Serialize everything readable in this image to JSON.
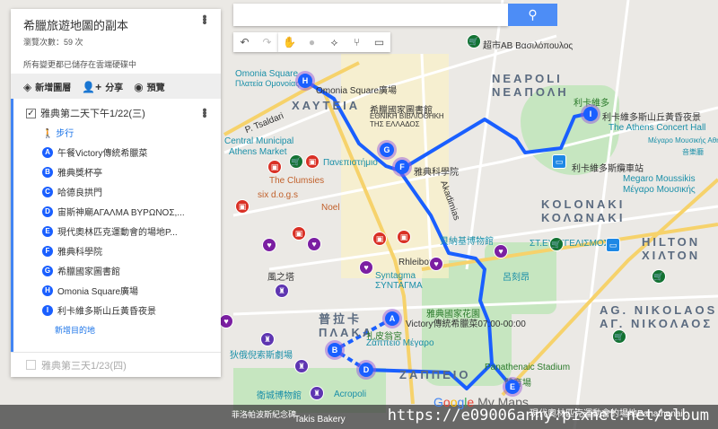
{
  "panel": {
    "title": "希臘旅遊地圖的副本",
    "views": "瀏覽次數：59 次",
    "saved": "所有變更都已儲存在雲端硬碟中",
    "tools": {
      "add_layer": "新增圖層",
      "share": "分享",
      "preview": "預覽"
    },
    "layer1": {
      "title": "雅典第二天下午1/22(三)",
      "mode": "步行",
      "add_dest": "新增目的地",
      "stops": [
        {
          "letter": "A",
          "name": "午餐Victory傳統希臘菜"
        },
        {
          "letter": "B",
          "name": "雅典獎杯亭"
        },
        {
          "letter": "C",
          "name": "哈德良拱門"
        },
        {
          "letter": "D",
          "name": "宙斯神廟ΑΓΑΛΜΑ ΒΥΡΩΝΟΣ,..."
        },
        {
          "letter": "E",
          "name": "現代奧林匹克運動會的場地P..."
        },
        {
          "letter": "F",
          "name": "雅典科學院"
        },
        {
          "letter": "G",
          "name": "希臘國家圖書館"
        },
        {
          "letter": "H",
          "name": "Omonia Square廣場"
        },
        {
          "letter": "I",
          "name": "利卡維多斯山丘黃昏夜景"
        }
      ]
    },
    "layer2": {
      "title": "雅典第三天1/23(四)"
    }
  },
  "map": {
    "districts": [
      {
        "a": "NEAPOLI",
        "b": "ΝΕΑΠΟΛΗ"
      },
      {
        "a": "ΧΑΥΤΕΙΑ",
        "b": ""
      },
      {
        "a": "KOLONAKI",
        "b": "ΚΟΛΩΝΑΚΙ"
      },
      {
        "a": "HILTON",
        "b": "ΧΙΛΤΟΝ"
      },
      {
        "a": "AG. NIKOLAOS",
        "b": "ΑΓ. ΝΙΚΟΛΑΟΣ"
      },
      {
        "a": "普拉卡",
        "b": "ΠΛΑΚΑ"
      },
      {
        "a": "ΖΑΠΠΕΙΟ",
        "b": ""
      }
    ],
    "labels": [
      "超市AB Βασιλόπουλος",
      "Omonia Square",
      "Πλατεία Ομονοίας",
      "Omonia Square廣場",
      "希臘國家圖書館",
      "ΕΘΝΙΚΗ ΒΙΒΛΙΟΘΗΚΗ",
      "ΤΗΣ ΕΛΛΑΔΟΣ",
      "雅典科學院",
      "利卡維多",
      "利卡維多斯山丘黃昏夜景",
      "The Athens Concert Hall",
      "Μέγαρο Μουσικής Αθηνών",
      "音樂廳",
      "利卡維多斯纜車站",
      "Megaro Moussikis",
      "Μέγαρο Μουσικής",
      "Central Municipal",
      "Athens Market",
      "Πανεπιστήμιο",
      "The Clumsies",
      "six d.o.g.s",
      "Noel",
      "貝納基博物館",
      "Syntagma",
      "ΣΥΝΤΑΓΜΑ",
      "呂刻昂",
      "雅典國家花園",
      "Victory傳統希臘菜07:00-00:00",
      "扎皮翁宮",
      "Ζάππειο Μέγαρο",
      "狄俄倪索斯劇場",
      "Panathenaic Stadium",
      "體育場",
      "衛城博物館",
      "Acropoli",
      "Takis Bakery",
      "現代奧林匹克運動會的場地Panathenai...",
      "P. Tsaldari",
      "Akadimias",
      "Rhleibor",
      "ΣΤ.ΕΥΑΓΓΕΛΙΣΜΟΣ",
      "風之塔",
      "菲洛帕波斯紀念碑"
    ],
    "logo": "Google My Maps"
  },
  "watermark": "https://e09006anny.pixnet.net/album",
  "colors": {
    "route": "#1a5fff",
    "search": "#4d8df6",
    "park": "#c6e6c0"
  }
}
